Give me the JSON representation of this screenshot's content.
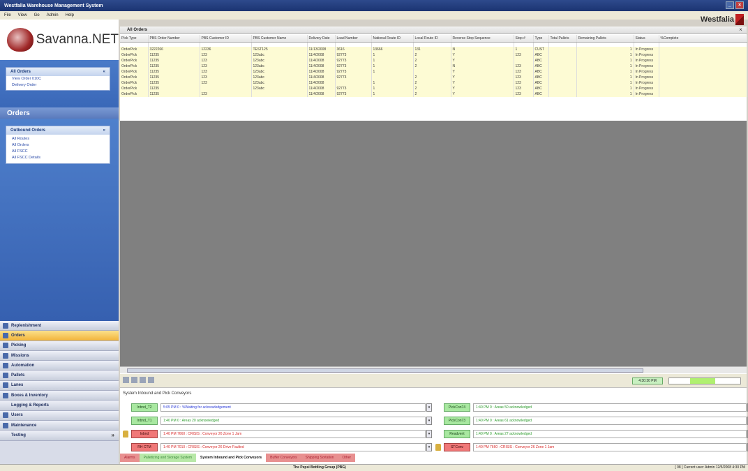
{
  "window": {
    "title": "Westfalia Warehouse Management System",
    "brand": "Westfalia"
  },
  "menu": [
    "File",
    "View",
    "Go",
    "Admin",
    "Help"
  ],
  "logo": {
    "name": "Savanna.NET"
  },
  "quick_panel": {
    "title": "All Orders",
    "items": [
      "View Order 010C",
      "Delivery Order"
    ]
  },
  "orders_section": {
    "title": "Orders"
  },
  "outbound_panel": {
    "title": "Outbound Orders",
    "items": [
      "All Routes",
      "All Orders",
      "All FSCC",
      "All FSCC Details"
    ]
  },
  "nav_items": [
    {
      "label": "Replenishment",
      "icon": "replenishment-icon",
      "active": false
    },
    {
      "label": "Orders",
      "icon": "orders-icon",
      "active": true
    },
    {
      "label": "Picking",
      "icon": "picking-icon",
      "active": false
    },
    {
      "label": "Missions",
      "icon": "missions-icon",
      "active": false
    },
    {
      "label": "Automation",
      "icon": "automation-icon",
      "active": false
    },
    {
      "label": "Pallets",
      "icon": "pallets-icon",
      "active": false
    },
    {
      "label": "Lanes",
      "icon": "lanes-icon",
      "active": false
    },
    {
      "label": "Boxes & Inventory",
      "icon": "boxes-icon",
      "active": false
    },
    {
      "label": "Logging & Reports",
      "icon": "",
      "active": false
    },
    {
      "label": "Users",
      "icon": "users-icon",
      "active": false
    },
    {
      "label": "Maintenance",
      "icon": "maintenance-icon",
      "active": false
    },
    {
      "label": "Testing",
      "icon": "",
      "active": false
    }
  ],
  "main": {
    "title": "All Orders",
    "columns": [
      "Pick Type",
      "PBS Order Number",
      "PBS Customer ID",
      "PBS Customer Name",
      "Delivery Date",
      "Load Number",
      "National Route ID",
      "Local Route ID",
      "Reverse Stop Sequence",
      "Stop #",
      "Type",
      "Total Pallets",
      "Remaining Pallets",
      "Status",
      "%Complete"
    ],
    "rows": [
      [
        "OrderPick",
        "3222266",
        "12236",
        "TEST125",
        "11/13/2008",
        "3616",
        "13666",
        "131",
        "N",
        "1",
        "CUST",
        "",
        "1",
        "In Progress",
        ""
      ],
      [
        "OrderPick",
        "11235",
        "123",
        "123abc",
        "11/4/2008",
        "92773",
        "1",
        "2",
        "Y",
        "123",
        "ABC",
        "",
        "1",
        "In Progress",
        ""
      ],
      [
        "OrderPick",
        "11235",
        "123",
        "123abc",
        "11/4/2008",
        "92773",
        "1",
        "2",
        "Y",
        "",
        "ABC",
        "",
        "1",
        "In Progress",
        ""
      ],
      [
        "OrderPick",
        "11235",
        "123",
        "123abc",
        "11/4/2008",
        "92773",
        "1",
        "2",
        "N",
        "123",
        "ABC",
        "",
        "1",
        "In Progress",
        ""
      ],
      [
        "OrderPick",
        "11235",
        "123",
        "123abc",
        "11/4/2008",
        "92773",
        "1",
        "",
        "Y",
        "123",
        "ABC",
        "",
        "1",
        "In Progress",
        ""
      ],
      [
        "OrderPick",
        "11235",
        "123",
        "123abc",
        "11/4/2008",
        "92773",
        "",
        "2",
        "Y",
        "123",
        "ABC",
        "",
        "1",
        "In Progress",
        ""
      ],
      [
        "OrderPick",
        "11235",
        "123",
        "123abc",
        "11/4/2008",
        "",
        "1",
        "2",
        "Y",
        "123",
        "ABC",
        "",
        "1",
        "In Progress",
        ""
      ],
      [
        "OrderPick",
        "11235",
        "",
        "123abc",
        "11/4/2008",
        "92773",
        "1",
        "2",
        "Y",
        "123",
        "ABC",
        "",
        "1",
        "In Progress",
        ""
      ],
      [
        "OrderPick",
        "11235",
        "123",
        "",
        "11/4/2008",
        "92773",
        "1",
        "2",
        "Y",
        "123",
        "ABC",
        "",
        "1",
        "In Progress",
        ""
      ]
    ]
  },
  "clock": "4:30:30 PM",
  "meter": {
    "fraction": 0.35
  },
  "system_section": {
    "title": "System Inbound and Pick Conveyors"
  },
  "status_rows": [
    {
      "button": "Inbnd_T2",
      "button_color": "green",
      "message": "5:05 PM 0 : %Waiting for acknowledgement",
      "msg_color": "blue",
      "locked": false
    },
    {
      "button": "PickCon74",
      "button_color": "green",
      "message": "1:40 PM 0 : Areas 50 acknowledged",
      "msg_color": "green",
      "locked": false
    },
    {
      "button": "Inbnd_T1",
      "button_color": "green",
      "message": "1:40 PM 0 : Areas 20 acknowledged",
      "msg_color": "green",
      "locked": false
    },
    {
      "button": "PickCon73",
      "button_color": "green",
      "message": "1:40 PM 0 : Areas 61 acknowledged",
      "msg_color": "green",
      "locked": false
    },
    {
      "button": "Inbnd",
      "button_color": "red",
      "message": "1:40 PM 7660 : CRISIS : Conveyor 26 Zone 1 Jam",
      "msg_color": "red",
      "locked": true
    },
    {
      "button": "Readvent",
      "button_color": "green",
      "message": "1:40 PM 0 : Areas 27 acknowledged",
      "msg_color": "green",
      "locked": false
    },
    {
      "button": "RH CTM",
      "button_color": "red",
      "message": "1:40 PM 7010 : CRISIS : Conveyor 26 Drive Faulted",
      "msg_color": "red",
      "locked": false
    },
    {
      "button": "STConv",
      "button_color": "red",
      "message": "1:40 PM 7660 : CRISIS : Conveyor 26 Zone 1 Jam",
      "msg_color": "red",
      "locked": true
    }
  ],
  "bottom_tabs": [
    {
      "label": "Alarms",
      "style": "red"
    },
    {
      "label": "Palletizing and Storage System",
      "style": "green"
    },
    {
      "label": "System Inbound and Pick Conveyors",
      "style": "sel"
    },
    {
      "label": "Buffer Conveyors",
      "style": "red"
    },
    {
      "label": "Shipping Sortation",
      "style": "red"
    },
    {
      "label": "Other",
      "style": "red"
    }
  ],
  "statusbar": {
    "center": "The Pepsi Bottling Group (PBG)",
    "right": "[ 08 ] Current user: Admin 12/5/2008 4:30 PM"
  }
}
